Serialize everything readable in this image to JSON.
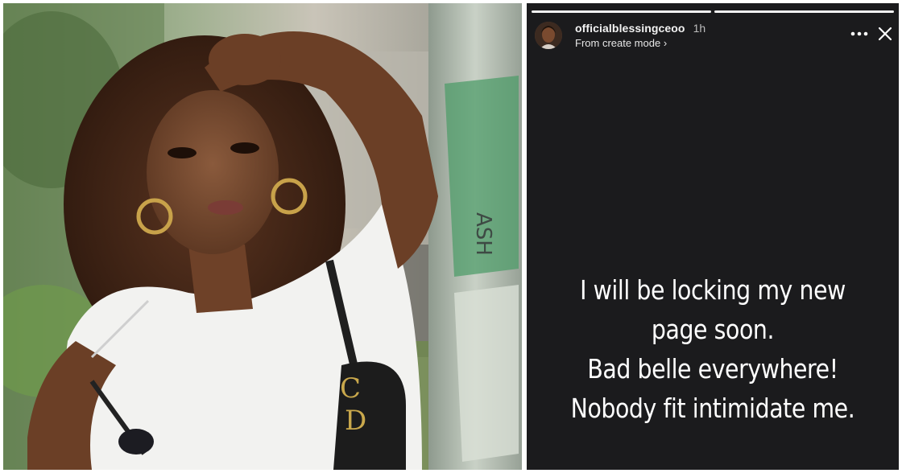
{
  "story": {
    "username": "officialblessingceoo",
    "time": "1h",
    "subtitle": "From create mode ›",
    "progress_segments": 2,
    "progress_filled": 1,
    "lines": [
      "I will be locking my new",
      "page soon.",
      "Bad belle everywhere!",
      "Nobody fit intimidate me."
    ]
  },
  "icons": {
    "more": "more-horizontal-icon",
    "close": "close-icon"
  },
  "colors": {
    "story_bg": "#1b1b1d",
    "text": "#ffffff",
    "muted": "#bdbdbd"
  }
}
